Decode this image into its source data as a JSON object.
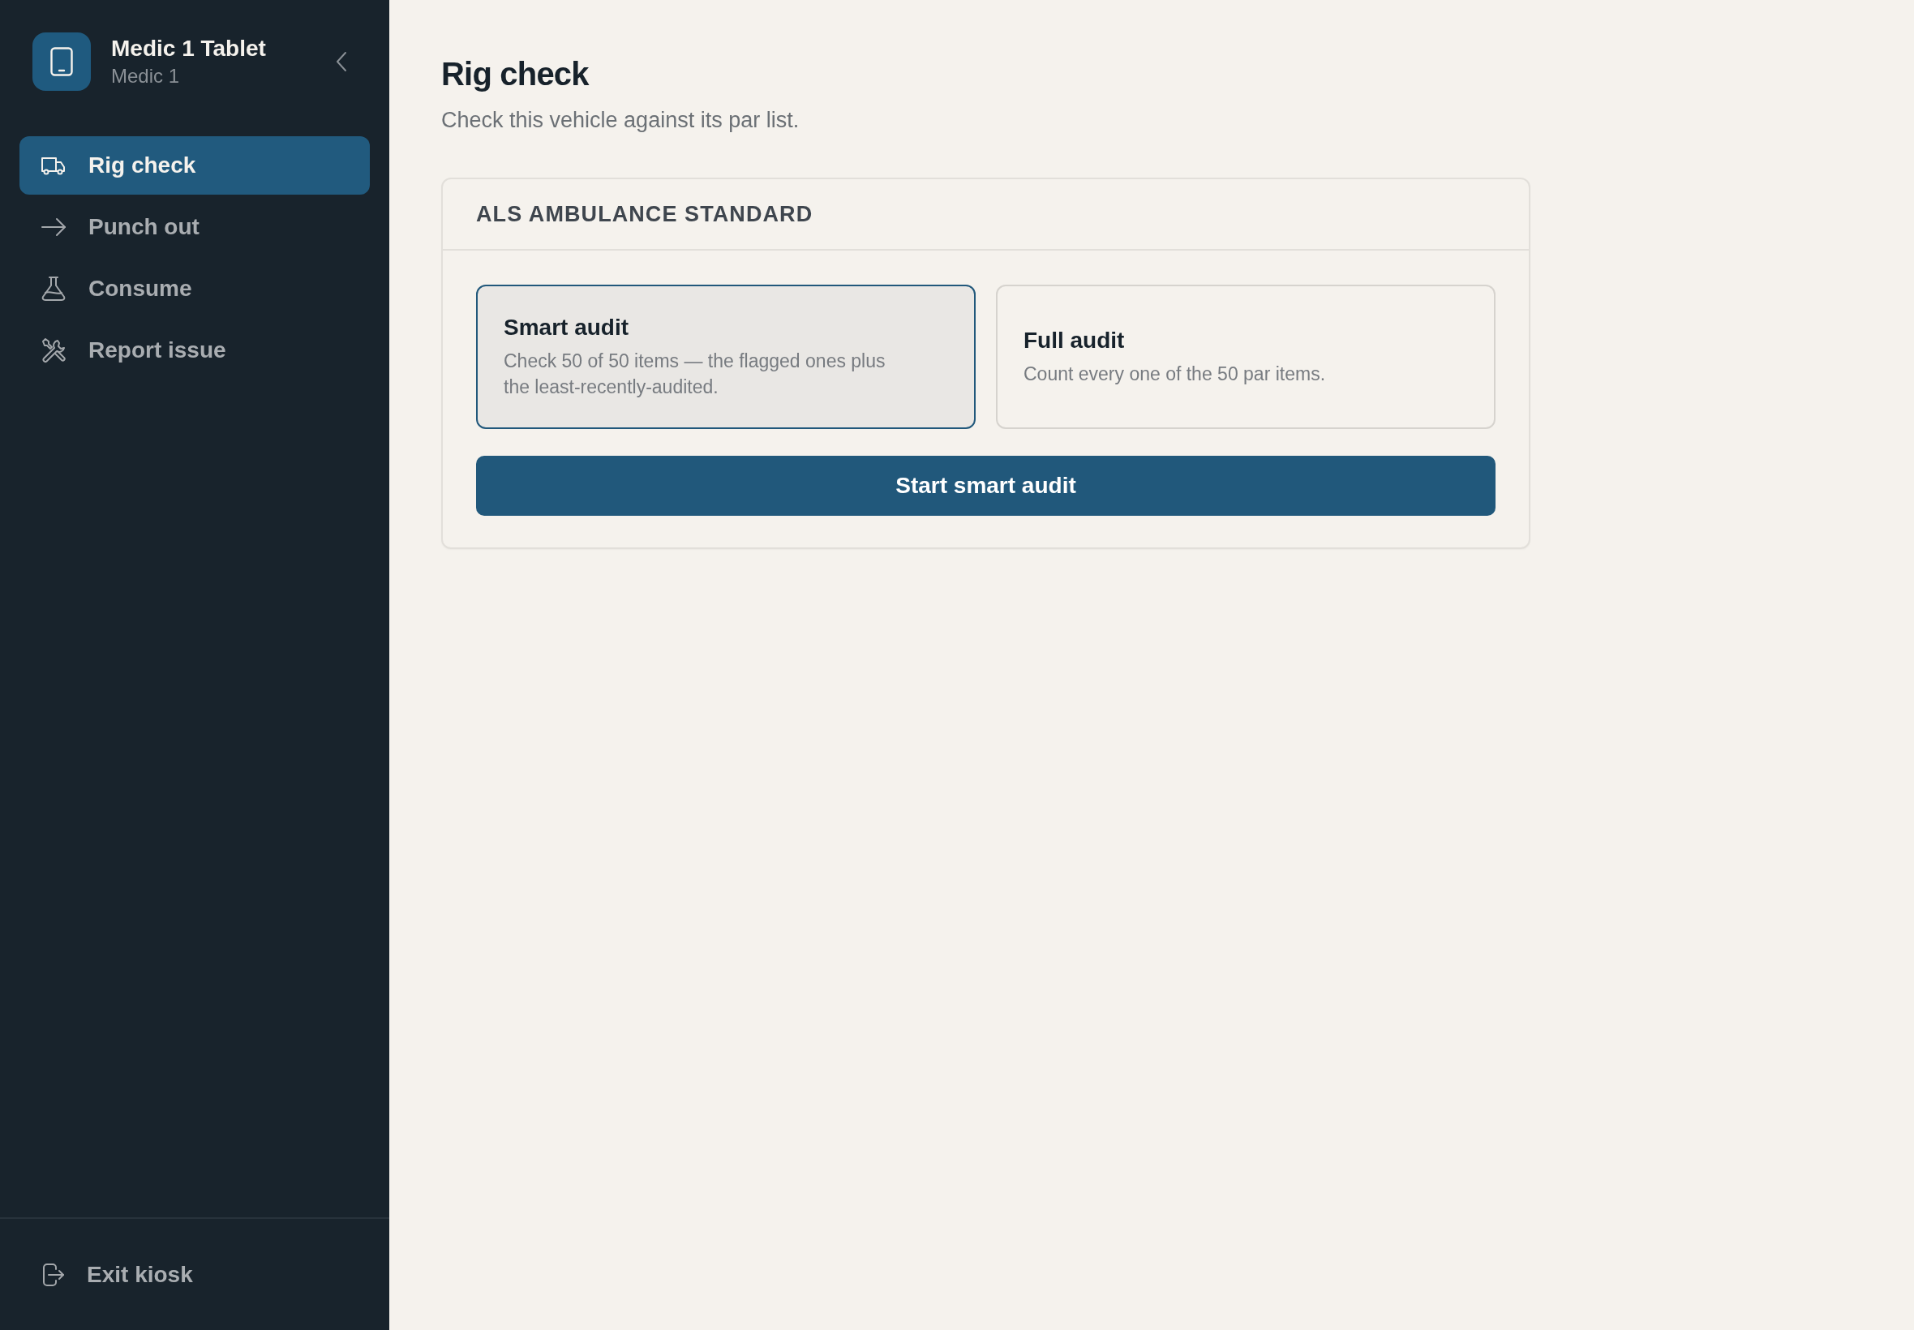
{
  "sidebar": {
    "device": {
      "title": "Medic 1 Tablet",
      "subtitle": "Medic 1"
    },
    "nav_items": [
      {
        "label": "Rig check",
        "kind": "truck",
        "selected": true
      },
      {
        "label": "Punch out",
        "kind": "arrow",
        "selected": false
      },
      {
        "label": "Consume",
        "kind": "flask",
        "selected": false
      },
      {
        "label": "Report issue",
        "kind": "tools",
        "selected": false
      }
    ],
    "footer_item": {
      "label": "Exit kiosk",
      "kind": "exit"
    }
  },
  "page": {
    "title": "Rig check",
    "subtitle": "Check this vehicle against its par list."
  },
  "card": {
    "title": "ALS AMBULANCE STANDARD",
    "options": [
      {
        "title": "Smart audit",
        "description": "Check 50 of 50 items — the flagged ones plus the least-recently-audited.",
        "selected": true
      },
      {
        "title": "Full audit",
        "description": "Count every one of the 50 par items.",
        "selected": false
      }
    ],
    "button": "Start smart audit"
  }
}
